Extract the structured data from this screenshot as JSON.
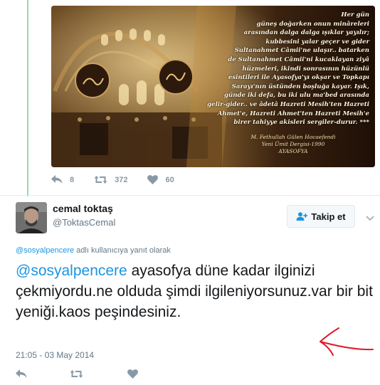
{
  "previous_tweet": {
    "media": {
      "quote_lines": [
        "Her gün",
        "güneş doğarken onun minâreleri",
        "arasından dalga dalga ışıklar yayılır;",
        "kubbesini yalar geçer ve gider",
        "Sultanahmet Câmii'ne ulaşır.. batarken",
        "de Sultanahmet Câmii'ni kucaklayan ziyâ",
        "hüzmeleri, ikindi sonrasının hüzünlü",
        "esintileri ile Ayasofya'yı okşar ve Topkapı",
        "Sarayı'nın üstünden boşluğa kayar. Işık,",
        "günde iki defa, bu iki ulu ma'bed arasında",
        "gelir-gider.. ve âdetâ Hazreti Mesih'ten Hazreti",
        "Ahmet'e, Hazreti Ahmet'ten Hazreti Mesih'e",
        "birer tahiyye akisleri sergiler-durur. ***"
      ],
      "signature_lines": [
        "M. Fethullah Gülen Hocaefendi",
        "Yeni Ümit Dergisi-1990",
        "AYASOFYA"
      ]
    },
    "actions": {
      "reply_count": "8",
      "retweet_count": "372",
      "like_count": "60"
    }
  },
  "tweet": {
    "author_name": "cemal toktaş",
    "author_handle": "@ToktasCemal",
    "follow_label": "Takip et",
    "reply_context": {
      "mention": "@sosyalpencere",
      "suffix": " adlı kullanıcıya yanıt olarak"
    },
    "mention": "@sosyalpencere",
    "text": " ayasofya düne kadar ilginizi çekmiyordu.ne olduda şimdi ilgileniyorsunuz.var bir bit yeniği.kaos peşindesiniz.",
    "timestamp": "21:05 - 03 May 2014"
  },
  "colors": {
    "link": "#1b95e0",
    "muted": "#657786",
    "icon": "#8899a6",
    "thread_line": "#98d7a6",
    "annotation_arrow": "#e0192b"
  },
  "icons": [
    "reply-icon",
    "retweet-icon",
    "like-icon",
    "follow-user-icon",
    "chevron-down-icon"
  ]
}
